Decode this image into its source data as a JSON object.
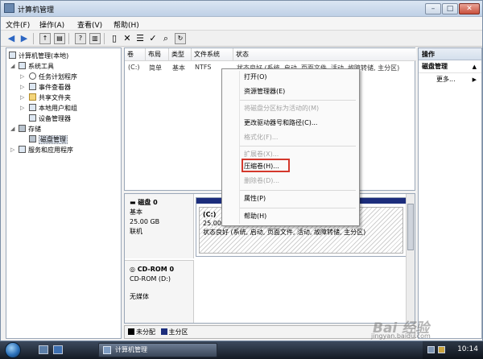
{
  "window": {
    "title": "计算机管理"
  },
  "menu": [
    "文件(F)",
    "操作(A)",
    "查看(V)",
    "帮助(H)"
  ],
  "tree": {
    "root": "计算机管理(本地)",
    "system_tools": "系统工具",
    "task_scheduler": "任务计划程序",
    "event_viewer": "事件查看器",
    "shared_folders": "共享文件夹",
    "local_users": "本地用户和组",
    "device_manager": "设备管理器",
    "storage": "存储",
    "disk_management": "磁盘管理",
    "services_apps": "服务和应用程序"
  },
  "volumes": {
    "columns": [
      "卷",
      "布局",
      "类型",
      "文件系统",
      "状态"
    ],
    "row": {
      "volume": "(C:)",
      "layout": "简单",
      "type": "基本",
      "fs": "NTFS",
      "status": "状态良好 (系统, 启动, 页面文件, 活动, 故障转储, 主分区)"
    }
  },
  "disk0": {
    "name": "磁盘 0",
    "type": "基本",
    "size": "25.00 GB",
    "state": "联机",
    "partition_name": "(C:)",
    "partition_size": "25.00 GB NTFS",
    "partition_status": "状态良好 (系统, 启动, 页面文件, 活动, 故障转储, 主分区)"
  },
  "cdrom": {
    "name": "CD-ROM 0",
    "drive": "CD-ROM (D:)",
    "media": "无媒体"
  },
  "legend": {
    "unallocated": "未分配",
    "primary": "主分区",
    "unallocated_color": "#000000",
    "primary_color": "#1c2d7c"
  },
  "actions": {
    "header": "操作",
    "section": "磁盘管理",
    "more": "更多..."
  },
  "context_menu": {
    "open": "打开(O)",
    "explorer": "资源管理器(E)",
    "mark_active": "将磁盘分区标为活动的(M)",
    "change_letter": "更改驱动器号和路径(C)...",
    "format": "格式化(F)...",
    "extend": "扩展卷(X)...",
    "shrink": "压缩卷(H)...",
    "delete": "删除卷(D)...",
    "properties": "属性(P)",
    "help": "帮助(H)"
  },
  "taskbar": {
    "active_task": "计算机管理",
    "clock": "10:14"
  },
  "watermark": {
    "brand": "Bai 经验",
    "url": "jingyan.baidu.com"
  }
}
